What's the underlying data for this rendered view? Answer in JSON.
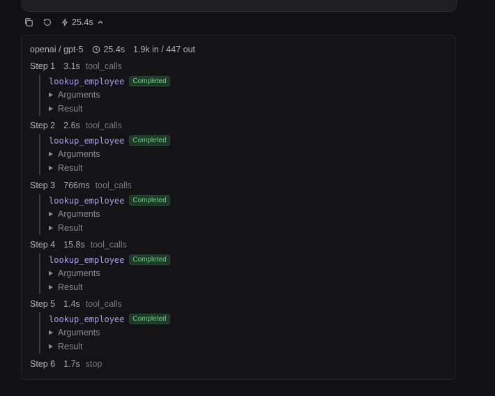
{
  "toolbar": {
    "duration": "25.4s"
  },
  "trace": {
    "model": "openai / gpt-5",
    "duration": "25.4s",
    "tokens": "1.9k in / 447 out"
  },
  "steps": [
    {
      "label": "Step 1",
      "time": "3.1s",
      "type": "tool_calls",
      "tool": "lookup_employee",
      "status": "Completed",
      "arguments": "Arguments",
      "result": "Result"
    },
    {
      "label": "Step 2",
      "time": "2.6s",
      "type": "tool_calls",
      "tool": "lookup_employee",
      "status": "Completed",
      "arguments": "Arguments",
      "result": "Result"
    },
    {
      "label": "Step 3",
      "time": "766ms",
      "type": "tool_calls",
      "tool": "lookup_employee",
      "status": "Completed",
      "arguments": "Arguments",
      "result": "Result"
    },
    {
      "label": "Step 4",
      "time": "15.8s",
      "type": "tool_calls",
      "tool": "lookup_employee",
      "status": "Completed",
      "arguments": "Arguments",
      "result": "Result"
    },
    {
      "label": "Step 5",
      "time": "1.4s",
      "type": "tool_calls",
      "tool": "lookup_employee",
      "status": "Completed",
      "arguments": "Arguments",
      "result": "Result"
    },
    {
      "label": "Step 6",
      "time": "1.7s",
      "type": "stop"
    }
  ]
}
